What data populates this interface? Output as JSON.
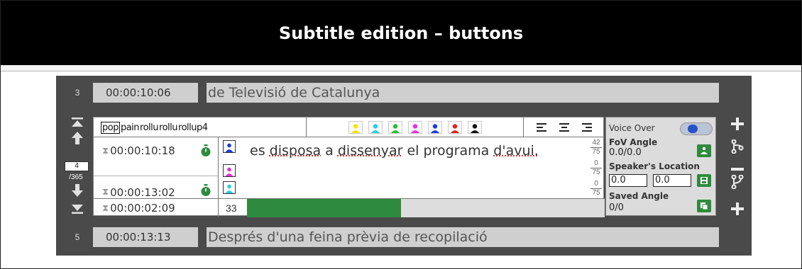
{
  "page_title": "Subtitle edition – buttons",
  "prev_row": {
    "number": "3",
    "timecode": "00:00:10:06",
    "text": "de Televisió de Catalunya"
  },
  "next_row": {
    "number": "5",
    "timecode": "00:00:13:13",
    "text": "Després d'una feina prèvia de recopilació"
  },
  "navigation": {
    "current": "4",
    "total": "/365"
  },
  "editor": {
    "modes": [
      "pop",
      "pain",
      "rollu",
      "rollu",
      "rollup4"
    ],
    "speaker_colors": [
      "#f2e600",
      "#22d0e8",
      "#22c02e",
      "#e82ee0",
      "#1a3ce0",
      "#e82020",
      "#111111"
    ],
    "time_in": "00:00:10:18",
    "time_out": "00:00:13:02",
    "duration": "00:00:02:09",
    "subtitle_words": [
      "es",
      "disposa",
      "a",
      "dissenyar",
      "el",
      "programa",
      "d'avui."
    ],
    "char_counts": [
      {
        "num": "42",
        "den": "75"
      },
      {
        "num": "0",
        "den": "75"
      },
      {
        "num": "0",
        "den": "75"
      }
    ],
    "reading_speed": "33",
    "progress_fraction": 0.43,
    "speaker_line_colors": [
      "#1a3ce0",
      "#e82ee0",
      "#22d0e8"
    ]
  },
  "side_panel": {
    "voice_over_label": "Voice Over",
    "fov_label": "FoV Angle",
    "fov_value": "0.0/0.0",
    "location_label": "Speaker's Location",
    "location_x": "0.0",
    "location_y": "0.0",
    "saved_label": "Saved Angle",
    "saved_value": "0/0"
  },
  "colors": {
    "accent_green": "#2e8b3d",
    "panel_dark": "#4a4a4a",
    "toggle_blue": "#2851c7"
  },
  "icons": [
    "top-arrow-icon",
    "up-arrow-icon",
    "down-arrow-icon",
    "bottom-arrow-icon",
    "timer-icon",
    "hourglass-icon",
    "speaker-person-icon",
    "align-left-icon",
    "align-center-icon",
    "align-right-icon",
    "compass-icon",
    "save-icon",
    "copy-icon",
    "plus-icon",
    "minus-icon",
    "split-icon",
    "merge-icon"
  ]
}
